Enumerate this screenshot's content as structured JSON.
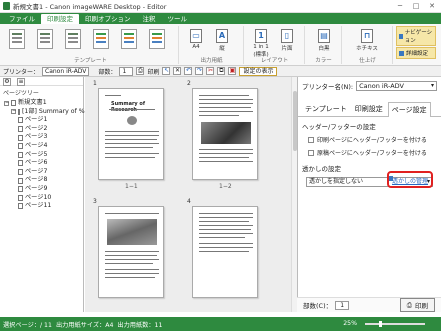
{
  "window": {
    "title": "新規文書1 - Canon imageWARE Desktop - Editor",
    "minimize": "─",
    "maximize": "□",
    "close": "✕"
  },
  "ribbon_tabs": [
    "ファイル",
    "印刷設定",
    "印刷オプション",
    "注釈",
    "ツール"
  ],
  "ribbon": {
    "template_group": "テンプレート",
    "output_group": "出力用紙",
    "paper_size": "A4",
    "orientation": "縦",
    "layout_group": "レイアウト",
    "nup": "1 in 1",
    "nup_sub": "(標準)",
    "duplex": "片面",
    "color_group": "カラー",
    "color": "白黒",
    "staple": "ホチキス",
    "finishing_group": "仕上げ",
    "navigation": "ナビゲーション",
    "detail_settings": "詳細設定"
  },
  "toolbar": {
    "printer_label": "プリンター：",
    "printer_value": "Canon iR-ADV",
    "copies_label": "部数：",
    "copies_value": "1",
    "print_button": "印刷",
    "settings_display": "設定の表示"
  },
  "left_pane": {
    "title": "ページツリー",
    "items": [
      {
        "label": "新規文書1",
        "level": 0,
        "expander": "−"
      },
      {
        "label": "[1部] Summary of %",
        "level": 1,
        "expander": "−"
      },
      {
        "label": "ページ1",
        "level": 2
      },
      {
        "label": "ページ2",
        "level": 2
      },
      {
        "label": "ページ3",
        "level": 2
      },
      {
        "label": "ページ4",
        "level": 2
      },
      {
        "label": "ページ5",
        "level": 2
      },
      {
        "label": "ページ6",
        "level": 2
      },
      {
        "label": "ページ7",
        "level": 2
      },
      {
        "label": "ページ8",
        "level": 2
      },
      {
        "label": "ページ9",
        "level": 2
      },
      {
        "label": "ページ10",
        "level": 2
      },
      {
        "label": "ページ11",
        "level": 2
      }
    ]
  },
  "pages": [
    {
      "num": "1",
      "caption": "1−1",
      "heading": "Summary of Research"
    },
    {
      "num": "2",
      "caption": "1−2"
    },
    {
      "num": "3",
      "caption": ""
    },
    {
      "num": "4",
      "caption": ""
    }
  ],
  "right_pane": {
    "printer_label": "プリンター名(N):",
    "printer_value": "Canon iR-ADV",
    "tabs": [
      "テンプレート",
      "印刷設定",
      "ページ設定"
    ],
    "header_footer_section": "ヘッダー/フッターの設定",
    "check_print_hf": "印刷ページにヘッダー/フッターを付ける",
    "check_original_hf": "原稿ページにヘッダー/フッターを付ける",
    "watermark_section": "透かしの設定",
    "watermark_value": "透かしを指定しない",
    "watermark_manage_link": "透かしの管理",
    "copies_label": "部数(C)：",
    "copies_value": "1",
    "print_button": "印刷"
  },
  "status": {
    "page": "選択ページ：/ 11",
    "output_size": "出力用紙サイズ：A4",
    "copies": "出力用紙数：11",
    "zoom": "25%"
  }
}
